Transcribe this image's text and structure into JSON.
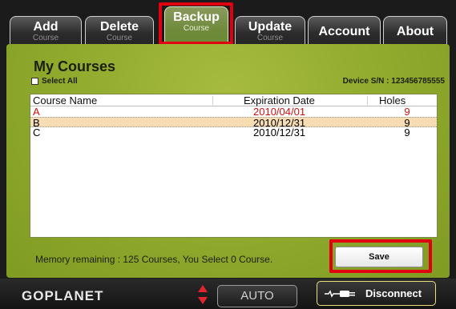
{
  "tabs": [
    {
      "line1": "Add",
      "line2": "Course"
    },
    {
      "line1": "Delete",
      "line2": "Course"
    },
    {
      "line1": "Backup",
      "line2": "Course"
    },
    {
      "line1": "Update",
      "line2": "Course"
    },
    {
      "line1": "Account",
      "line2": ""
    },
    {
      "line1": "About",
      "line2": ""
    }
  ],
  "active_tab": "Backup",
  "page": {
    "title": "My Courses",
    "select_all_label": "Select All",
    "device_sn": "Device S/N : 123456785555"
  },
  "table": {
    "headers": {
      "name": "Course Name",
      "date": "Expiration Date",
      "holes": "Holes"
    },
    "rows": [
      {
        "name": "A",
        "date": "2010/04/01",
        "holes": "9",
        "state": "expired"
      },
      {
        "name": "B",
        "date": "2010/12/31",
        "holes": "9",
        "state": "selected"
      },
      {
        "name": "C",
        "date": "2010/12/31",
        "holes": "9",
        "state": "normal"
      }
    ]
  },
  "footer": {
    "memory_text": "Memory remaining : 125 Courses, You Select 0 Course.",
    "save_label": "Save"
  },
  "bottombar": {
    "logo": "GOPLANET",
    "auto_label": "AUTO",
    "disconnect_label": "Disconnect"
  },
  "colors": {
    "highlight_red": "#e0000f",
    "expired_text": "#d01010",
    "selected_row": "#f8dcb4",
    "panel_green": "#8ea92c"
  }
}
